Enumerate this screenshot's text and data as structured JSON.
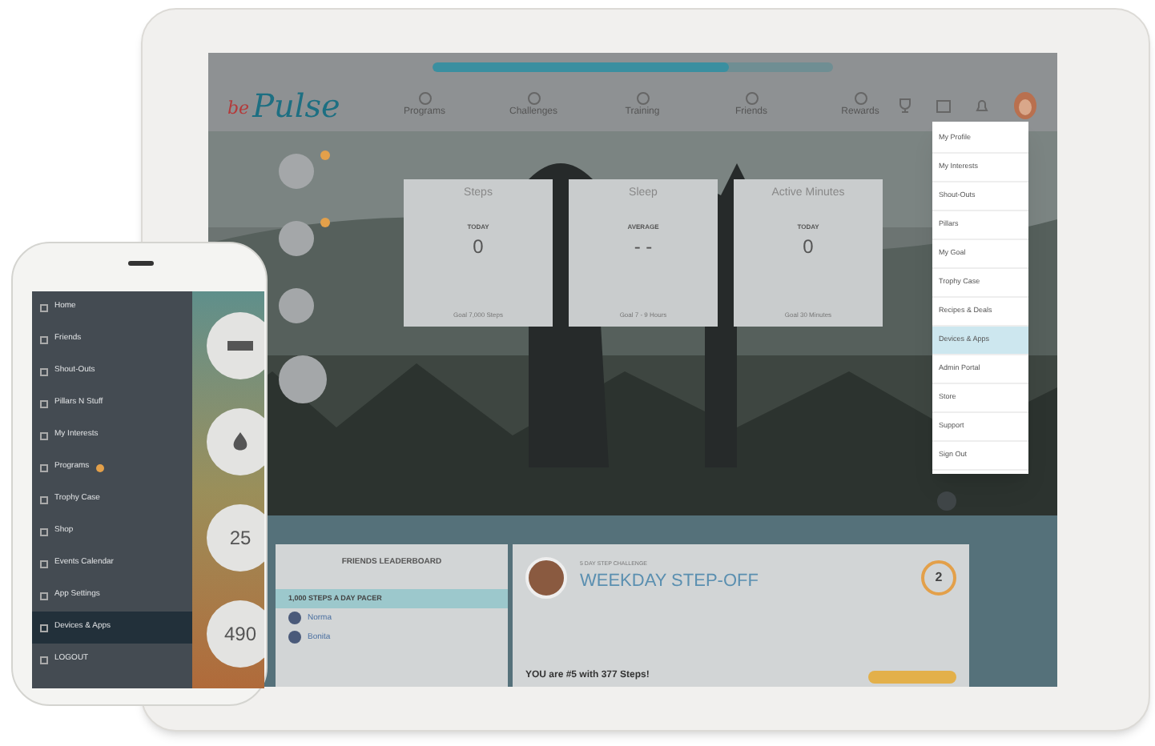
{
  "tablet": {
    "logo": {
      "prefix": "be",
      "name": "Pulse"
    },
    "nav": [
      {
        "label": "Programs"
      },
      {
        "label": "Challenges"
      },
      {
        "label": "Training"
      },
      {
        "label": "Friends"
      },
      {
        "label": "Rewards"
      }
    ],
    "progress": {
      "level": 0.74
    },
    "side_buttons": [
      {
        "badge": true
      },
      {
        "badge": true
      },
      {
        "badge": false
      },
      {
        "badge": false
      }
    ],
    "cards": [
      {
        "title": "Steps",
        "caption": "TODAY",
        "value": "0",
        "goal": "Goal 7,000 Steps"
      },
      {
        "title": "Sleep",
        "caption": "AVERAGE",
        "value": "- -",
        "goal": "Goal 7 - 9 Hours"
      },
      {
        "title": "Active Minutes",
        "caption": "TODAY",
        "value": "0",
        "goal": "Goal 30 Minutes"
      }
    ],
    "profile_menu": [
      {
        "label": "My Profile",
        "selected": false
      },
      {
        "label": "My Interests",
        "selected": false
      },
      {
        "label": "Shout-Outs",
        "selected": false
      },
      {
        "label": "Pillars",
        "selected": false
      },
      {
        "label": "My Goal",
        "selected": false
      },
      {
        "label": "Trophy Case",
        "selected": false
      },
      {
        "label": "Recipes & Deals",
        "selected": false
      },
      {
        "label": "Devices & Apps",
        "selected": true
      },
      {
        "label": "Admin Portal",
        "selected": false
      },
      {
        "label": "Store",
        "selected": false
      },
      {
        "label": "Support",
        "selected": false
      },
      {
        "label": "Sign Out",
        "selected": false
      }
    ],
    "leaderboard": {
      "title": "FRIENDS LEADERBOARD",
      "group": "1,000 STEPS A DAY PACER",
      "rows": [
        {
          "name": "Norma"
        },
        {
          "name": "Bonita"
        }
      ]
    },
    "challenge": {
      "kicker": "5 DAY STEP CHALLENGE",
      "title": "WEEKDAY STEP-OFF",
      "days": "2",
      "status": "YOU are #5 with 377 Steps!"
    }
  },
  "phone": {
    "menu": [
      {
        "label": "Home",
        "selected": false,
        "badge": false
      },
      {
        "label": "Friends",
        "selected": false,
        "badge": false
      },
      {
        "label": "Shout-Outs",
        "selected": false,
        "badge": false
      },
      {
        "label": "Pillars N Stuff",
        "selected": false,
        "badge": false
      },
      {
        "label": "My Interests",
        "selected": false,
        "badge": false
      },
      {
        "label": "Programs",
        "selected": false,
        "badge": true
      },
      {
        "label": "Trophy Case",
        "selected": false,
        "badge": false
      },
      {
        "label": "Shop",
        "selected": false,
        "badge": false
      },
      {
        "label": "Events Calendar",
        "selected": false,
        "badge": false
      },
      {
        "label": "App Settings",
        "selected": false,
        "badge": false
      },
      {
        "label": "Devices & Apps",
        "selected": true,
        "badge": false
      },
      {
        "label": "LOGOUT",
        "selected": false,
        "badge": false
      }
    ],
    "tiles": [
      {
        "kind": "icon"
      },
      {
        "kind": "icon"
      },
      {
        "kind": "number",
        "value": "25"
      },
      {
        "kind": "number",
        "value": "490"
      }
    ]
  }
}
